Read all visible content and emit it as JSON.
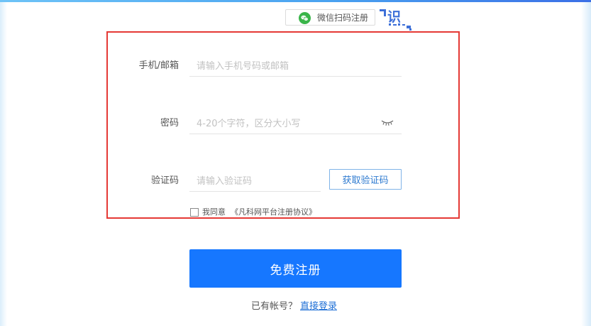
{
  "colors": {
    "accent": "#1677ff",
    "highlight_border": "#e53935",
    "wechat_green": "#3ab54a",
    "link": "#1e6fd6"
  },
  "wechat_scan": {
    "icon": "wechat-icon",
    "label": "微信扫码注册"
  },
  "qr_corner": {
    "icon": "qr-code-icon",
    "glyph": "识"
  },
  "form": {
    "phone_email": {
      "label": "手机/邮箱",
      "value": "",
      "placeholder": "请输入手机号码或邮箱"
    },
    "password": {
      "label": "密码",
      "value": "",
      "placeholder": "4-20个字符，区分大小写",
      "toggle_icon": "eye-closed-icon"
    },
    "captcha": {
      "label": "验证码",
      "value": "",
      "placeholder": "请输入验证码",
      "button_label": "获取验证码"
    },
    "agreement": {
      "checked": false,
      "prefix": "我同意",
      "link": "《凡科网平台注册协议》"
    }
  },
  "register_button": "免费注册",
  "login_prompt": {
    "text": "已有帐号？",
    "link": "直接登录"
  }
}
